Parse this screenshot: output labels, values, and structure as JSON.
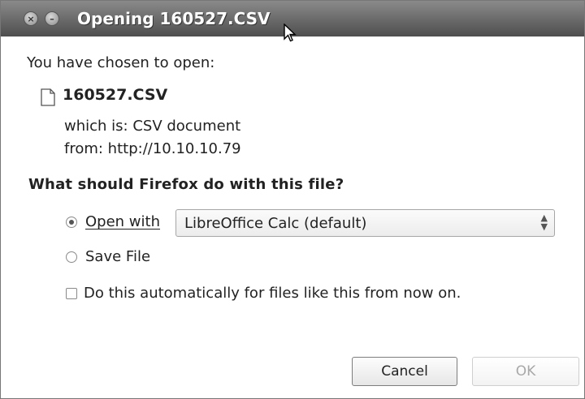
{
  "window": {
    "title": "Opening 160527.CSV"
  },
  "dialog": {
    "intro": "You have chosen to open:",
    "file_name": "160527.CSV",
    "which_is": "which is: CSV document",
    "from": "from: http://10.10.10.79",
    "question": "What should Firefox do with this file?",
    "open_with_label": "Open with",
    "open_with_value": "LibreOffice Calc (default)",
    "save_file_label": "Save File",
    "auto_label": "Do this automatically for files like this from now on.",
    "selected_action": "Open with",
    "auto_checked": false
  },
  "buttons": {
    "cancel_label": "Cancel",
    "ok_label": "OK",
    "ok_enabled": false
  },
  "icons": {
    "close": "close-icon",
    "minimize": "minimize-icon",
    "file": "file-icon",
    "cursor": "mouse-cursor-icon"
  }
}
